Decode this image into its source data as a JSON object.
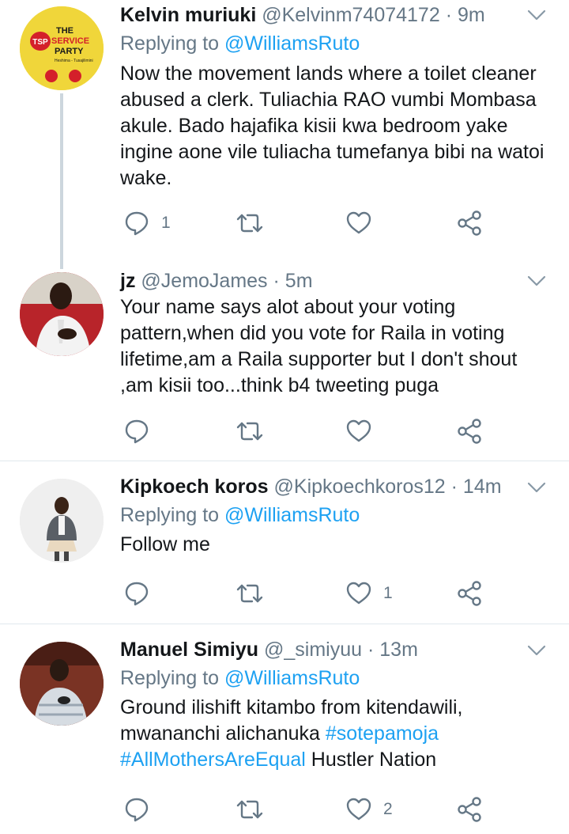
{
  "colors": {
    "accent": "#1da1f2",
    "secondary_text": "#657786",
    "primary_text": "#14171a",
    "divider": "#e1e8ed"
  },
  "tweets": [
    {
      "name": "Kelvin muriuki",
      "handle": "@Kelvinm74074172",
      "dot": "·",
      "time": "9m",
      "replying_prefix": "Replying to ",
      "replying_to": "@WilliamsRuto",
      "text": "Now the movement lands where a toilet cleaner abused a clerk. Tuliachia RAO vumbi Mombasa akule. Bado hajafika kisii kwa bedroom yake ingine aone vile tuliacha tumefanya bibi na watoi wake.",
      "reply_count": "1",
      "retweet_count": "",
      "like_count": "",
      "avatar_logo": {
        "line1": "THE",
        "line2": "SERVICE",
        "line3": "PARTY",
        "badge": "TSP",
        "tagline": "Heshima - Tusajilimini"
      }
    },
    {
      "name": "jz",
      "handle": "@JemoJames",
      "dot": "·",
      "time": "5m",
      "text": "Your name says alot about your voting pattern,when did you vote for Raila in voting lifetime,am a Raila supporter but I don't shout ,am kisii too...think b4 tweeting puga",
      "reply_count": "",
      "retweet_count": "",
      "like_count": ""
    },
    {
      "name": "Kipkoech koros",
      "handle": "@Kipkoechkoros12",
      "dot": "·",
      "time": "14m",
      "replying_prefix": "Replying to ",
      "replying_to": "@WilliamsRuto",
      "text": "Follow me",
      "reply_count": "",
      "retweet_count": "",
      "like_count": "1"
    },
    {
      "name": "Manuel Simiyu",
      "handle": "@_simiyuu",
      "dot": "·",
      "time": "13m",
      "replying_prefix": "Replying to ",
      "replying_to": "@WilliamsRuto",
      "text_part1": "Ground ilishift kitambo from kitendawili, mwananchi alichanuka ",
      "hashtag1": "#sotepamoja",
      "hashtag2": "#AllMothersAreEqual",
      "text_part2": " Hustler Nation",
      "reply_count": "",
      "retweet_count": "",
      "like_count": "2"
    }
  ],
  "icons": [
    "reply-icon",
    "retweet-icon",
    "like-icon",
    "share-icon",
    "chevron-down-icon"
  ]
}
